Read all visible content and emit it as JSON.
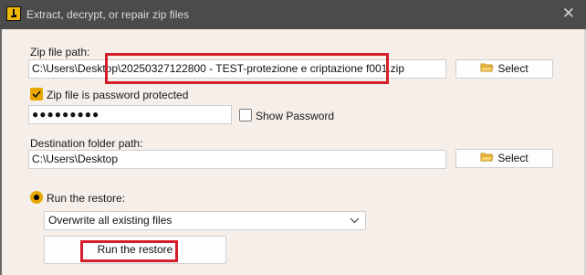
{
  "window": {
    "title": "Extract, decrypt, or repair zip files"
  },
  "zip": {
    "label": "Zip file path:",
    "path_prefix": "C:\\Users\\Desktop",
    "path_suffix": "\\20250327122800 - TEST-protezione e criptazione f001.zip",
    "select_label": "Select"
  },
  "password": {
    "checkbox_label": "Zip file is password protected",
    "value": "●●●●●●●●●",
    "show_label": "Show Password"
  },
  "destination": {
    "label": "Destination folder path:",
    "path": "C:\\Users\\Desktop",
    "select_label": "Select"
  },
  "restore": {
    "radio_label": "Run the restore:",
    "option_selected": "Overwrite all existing files",
    "run_button_label": "Run the restore"
  },
  "colors": {
    "accent": "#e8a800",
    "highlight": "#d61e2a",
    "titlebar": "#4b4b4b",
    "background": "#f5eee9"
  }
}
